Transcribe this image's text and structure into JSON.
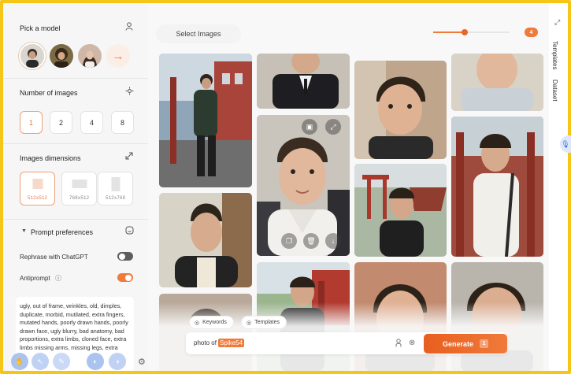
{
  "left": {
    "pick_model_title": "Pick a model",
    "num_images_title": "Number of images",
    "num_options": [
      "1",
      "2",
      "4",
      "8"
    ],
    "num_selected": "1",
    "dims_title": "Images dimensions",
    "dims": [
      {
        "label": "512x512",
        "selected": true
      },
      {
        "label": "768x512",
        "selected": false
      },
      {
        "label": "512x768",
        "selected": false
      }
    ],
    "prompt_pref_title": "Prompt preferences",
    "rephrase_label": "Rephrase with ChatGPT",
    "rephrase_on": false,
    "antiprompt_label": "Antiprompt",
    "antiprompt_on": true,
    "antiprompt_text": "ugly, out of frame, wrinkles, old, dimples, duplicate, morbid, mutilated, extra fingers, mutated hands, poorly drawn hands, poorly drawn face, ugly blurry, bad anatomy, bad proportions, extra limbs, cloned face, extra limbs missing arms, missing legs, extra"
  },
  "main": {
    "select_images_label": "Select Images",
    "count_badge": "4",
    "slider_level": 0.41,
    "chips": {
      "keywords": "Keywords",
      "templates": "Templates"
    },
    "prompt_prefix": "photo of",
    "prompt_token": "Spike54",
    "generate_label": "Generate",
    "generate_count": "1"
  },
  "right": {
    "templates_tab": "Templates",
    "dataset_tab": "Dataset"
  },
  "colors": {
    "accent": "#f07a3a",
    "frame": "#f5c518"
  },
  "icons": [
    "user-icon",
    "arrow-right-icon",
    "settings-icon",
    "expand-icon",
    "chevron-down-icon",
    "smile-icon",
    "info-icon",
    "keywords-icon",
    "templates-icon",
    "gender-icon",
    "close-circle-icon",
    "microphone-icon",
    "gear-icon",
    "image-icon",
    "fullscreen-icon",
    "copy-icon",
    "trash-icon",
    "download-icon"
  ]
}
